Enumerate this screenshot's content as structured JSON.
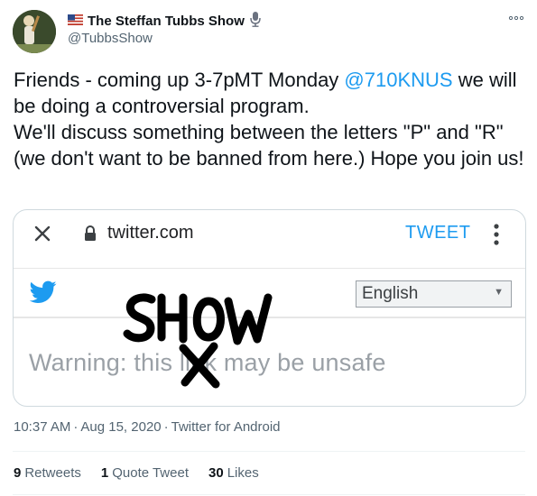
{
  "author": {
    "flag_icon": "us-flag-icon",
    "display_name": "The Steffan Tubbs Show",
    "mic_icon": "microphone-icon",
    "handle": "@TubbsShow"
  },
  "more_icon": "ooo",
  "tweet": {
    "text_before": "Friends - coming up 3-7pMT Monday ",
    "mention": "@710KNUS",
    "text_after": " we will be doing a controversial program.\nWe'll discuss something between the letters \"P\" and \"R\" (we don't want to be banned from here.) Hope you join us!"
  },
  "card": {
    "url": "twitter.com",
    "tweet_button": "TWEET",
    "language_select": "English",
    "warning": "Warning: this link may be unsafe",
    "scribble_word": "SHOW",
    "colors": {
      "accent": "#1d9bf0",
      "warning_gray": "#9aa0a6"
    }
  },
  "meta": {
    "time": "10:37 AM",
    "date": "Aug 15, 2020",
    "source": "Twitter for Android"
  },
  "stats": {
    "retweets_count": "9",
    "retweets_label": "Retweets",
    "quotes_count": "1",
    "quotes_label": "Quote Tweet",
    "likes_count": "30",
    "likes_label": "Likes"
  }
}
